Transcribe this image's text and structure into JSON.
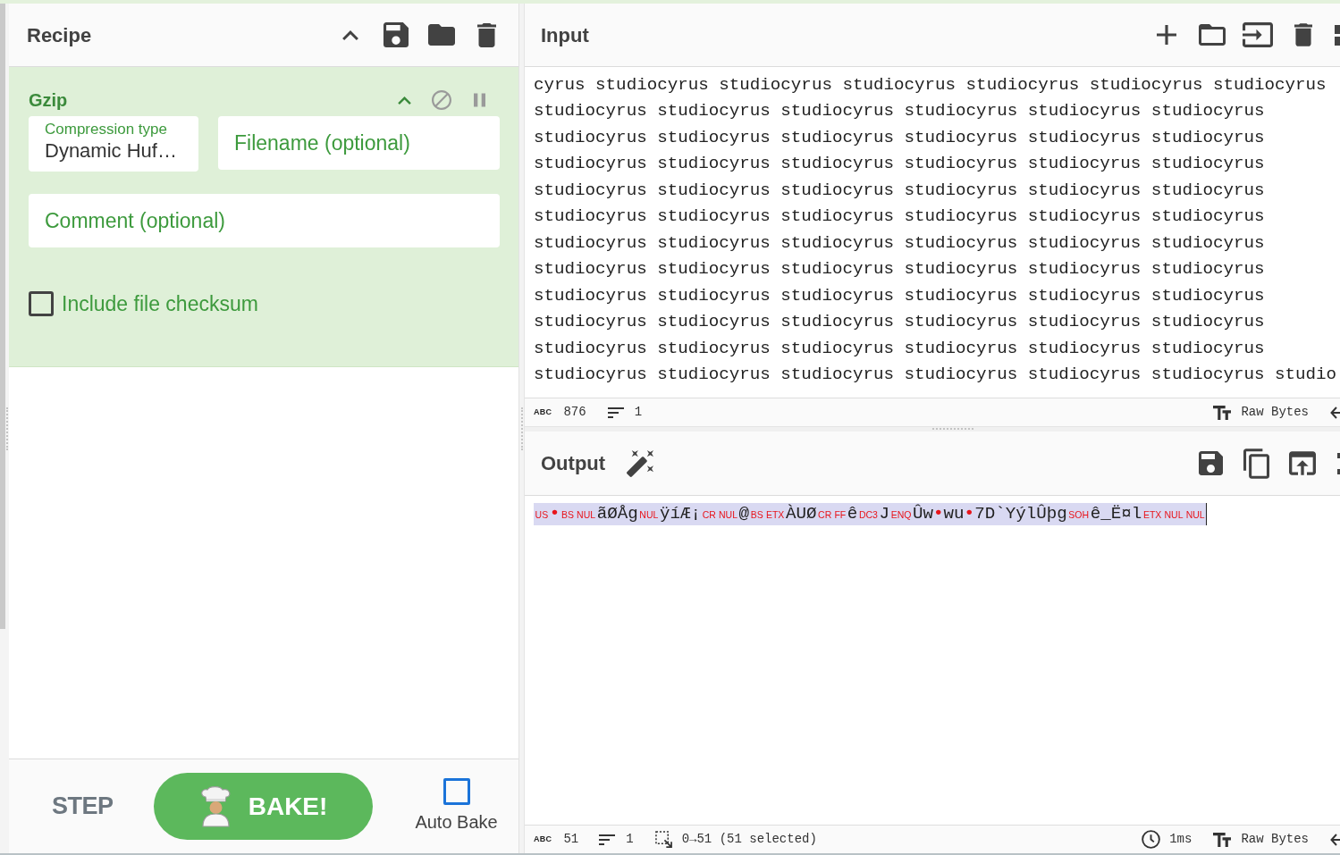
{
  "recipe": {
    "title": "Recipe",
    "operations": [
      {
        "name": "Gzip",
        "disabled": false,
        "breakpoint": false,
        "arg_rows": [
          [
            {
              "kind": "select",
              "label": "Compression type",
              "value": "Dynamic Huf…"
            },
            {
              "kind": "text",
              "placeholder": "Filename (optional)"
            }
          ],
          [
            {
              "kind": "text",
              "placeholder": "Comment (optional)"
            }
          ],
          [
            {
              "kind": "checkbox",
              "label": "Include file checksum",
              "checked": false
            }
          ]
        ]
      }
    ]
  },
  "controls": {
    "step": "STEP",
    "bake": "BAKE!",
    "auto_bake": {
      "label": "Auto Bake",
      "checked": false
    }
  },
  "input": {
    "title": "Input",
    "lines": [
      "cyrus studiocyrus studiocyrus studiocyrus studiocyrus studiocyrus studiocyrus",
      "studiocyrus studiocyrus studiocyrus studiocyrus studiocyrus studiocyrus",
      "studiocyrus studiocyrus studiocyrus studiocyrus studiocyrus studiocyrus",
      "studiocyrus studiocyrus studiocyrus studiocyrus studiocyrus studiocyrus",
      "studiocyrus studiocyrus studiocyrus studiocyrus studiocyrus studiocyrus",
      "studiocyrus studiocyrus studiocyrus studiocyrus studiocyrus studiocyrus",
      "studiocyrus studiocyrus studiocyrus studiocyrus studiocyrus studiocyrus",
      "studiocyrus studiocyrus studiocyrus studiocyrus studiocyrus studiocyrus",
      "studiocyrus studiocyrus studiocyrus studiocyrus studiocyrus studiocyrus",
      "studiocyrus studiocyrus studiocyrus studiocyrus studiocyrus studiocyrus",
      "studiocyrus studiocyrus studiocyrus studiocyrus studiocyrus studiocyrus",
      "studiocyrus studiocyrus studiocyrus studiocyrus studiocyrus studiocyrus studio"
    ],
    "status": {
      "length_glyph": "ABC",
      "length": "876",
      "lines": "1",
      "format": "Raw Bytes"
    }
  },
  "output": {
    "title": "Output",
    "selected": true,
    "segments": [
      {
        "kind": "control",
        "text": "US"
      },
      {
        "kind": "dot",
        "text": "•"
      },
      {
        "kind": "control",
        "text": "BS"
      },
      {
        "kind": "control",
        "text": "NUL"
      },
      {
        "kind": "text",
        "text": "ãØÅg"
      },
      {
        "kind": "control",
        "text": "NUL"
      },
      {
        "kind": "text",
        "text": "ÿíÆ¡"
      },
      {
        "kind": "control",
        "text": "CR"
      },
      {
        "kind": "control",
        "text": "NUL"
      },
      {
        "kind": "text",
        "text": "@"
      },
      {
        "kind": "control",
        "text": "BS"
      },
      {
        "kind": "control",
        "text": "ETX"
      },
      {
        "kind": "text",
        "text": "ÀUØ"
      },
      {
        "kind": "control",
        "text": "CR"
      },
      {
        "kind": "control",
        "text": "FF"
      },
      {
        "kind": "text",
        "text": "ê"
      },
      {
        "kind": "control",
        "text": "DC3"
      },
      {
        "kind": "text",
        "text": "J"
      },
      {
        "kind": "control",
        "text": "ENQ"
      },
      {
        "kind": "text",
        "text": "Ûw"
      },
      {
        "kind": "dot",
        "text": "•"
      },
      {
        "kind": "text",
        "text": "wu"
      },
      {
        "kind": "dot",
        "text": "•"
      },
      {
        "kind": "text",
        "text": "7D`YýlÛþg"
      },
      {
        "kind": "control",
        "text": "SOH"
      },
      {
        "kind": "text",
        "text": "ê_Ë¤l"
      },
      {
        "kind": "control",
        "text": "ETX"
      },
      {
        "kind": "control",
        "text": "NUL"
      },
      {
        "kind": "control",
        "text": "NUL"
      }
    ],
    "status": {
      "length_glyph": "ABC",
      "length": "51",
      "lines": "1",
      "selection": "0→51 (51 selected)",
      "time": "1ms",
      "format": "Raw Bytes"
    }
  }
}
